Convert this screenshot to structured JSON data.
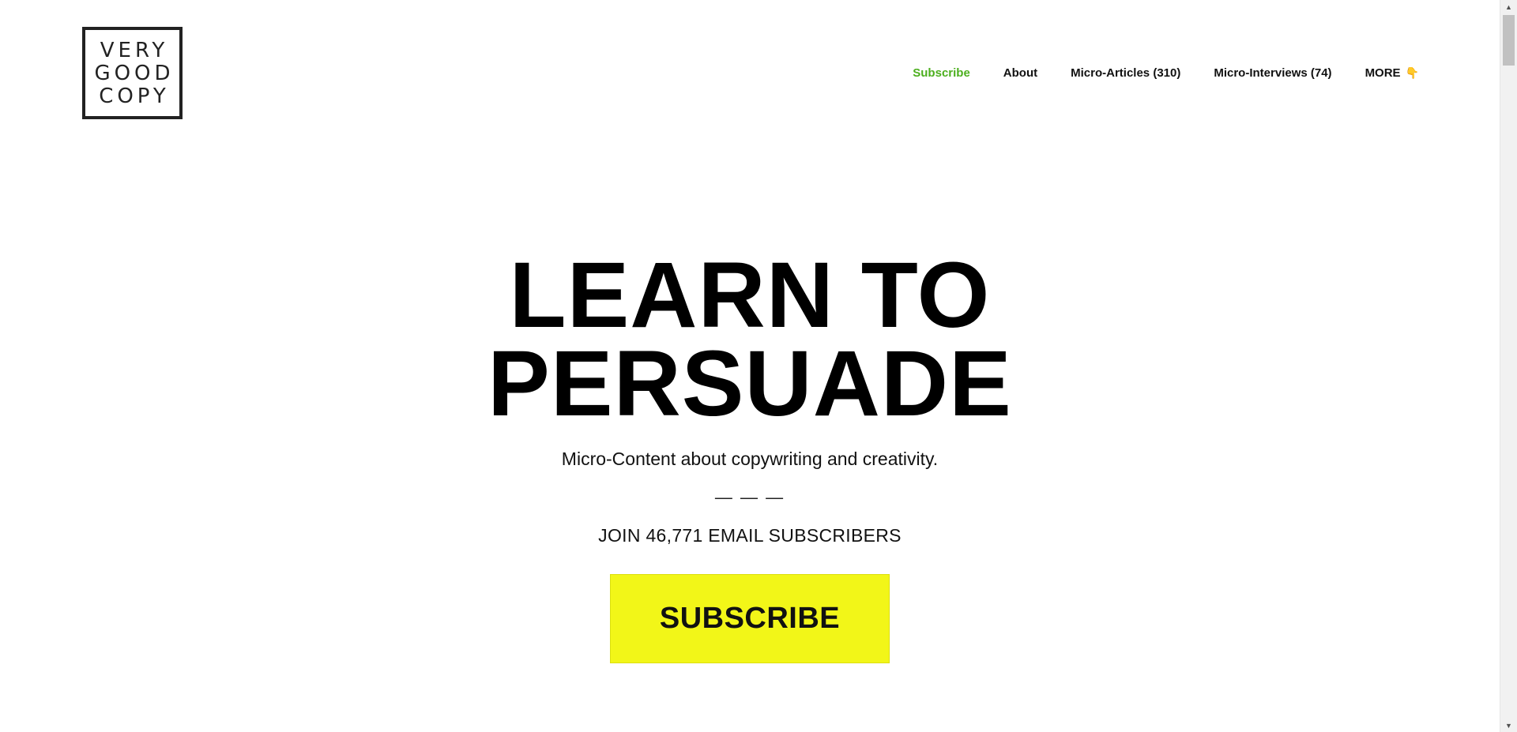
{
  "logo": {
    "lines": [
      "VERY",
      "GOOD",
      "COPY"
    ]
  },
  "nav": {
    "items": [
      {
        "label": "Subscribe"
      },
      {
        "label": "About"
      },
      {
        "label": "Micro-Articles (310)"
      },
      {
        "label": "Micro-Interviews (74)"
      },
      {
        "label": "MORE"
      }
    ],
    "more_icon": "👇"
  },
  "hero": {
    "title_line1": "LEARN TO",
    "title_line2": "PERSUADE",
    "subtitle": "Micro-Content about copywriting and creativity.",
    "divider": "— — —",
    "join_text": "JOIN 46,771 EMAIL SUBSCRIBERS",
    "cta_label": "SUBSCRIBE"
  },
  "colors": {
    "accent_green": "#4caf1e",
    "cta_yellow": "#f2f618"
  },
  "icons": {
    "more": "pointing-down-hand-icon"
  }
}
